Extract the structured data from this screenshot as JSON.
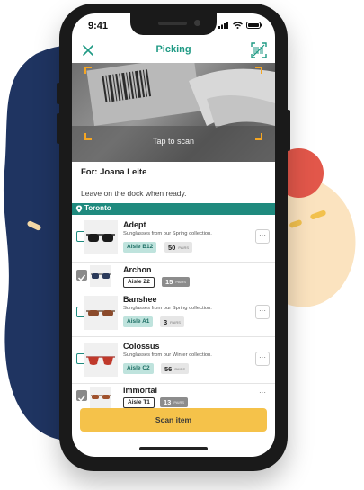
{
  "status_bar": {
    "time": "9:41"
  },
  "header": {
    "title": "Picking"
  },
  "camera": {
    "hint": "Tap to scan"
  },
  "order": {
    "for_label": "For: Joana Leite",
    "note": "Leave on the dock when ready."
  },
  "location": {
    "name": "Toronto"
  },
  "items": [
    {
      "name": "Adept",
      "description": "Sunglasses from our Spring collection.",
      "aisle": "Aisle B12",
      "qty": "50",
      "unit": "PAIRS",
      "checked": false
    },
    {
      "name": "Archon",
      "description": "",
      "aisle": "Aisle Z2",
      "qty": "15",
      "unit": "PAIRS",
      "checked": true
    },
    {
      "name": "Banshee",
      "description": "Sunglasses from our Spring collection.",
      "aisle": "Aisle A1",
      "qty": "3",
      "unit": "PAIRS",
      "checked": false
    },
    {
      "name": "Colossus",
      "description": "Sunglasses from our Winter collection.",
      "aisle": "Aisle C2",
      "qty": "56",
      "unit": "PAIRS",
      "checked": false
    },
    {
      "name": "Immortal",
      "description": "",
      "aisle": "Aisle T1",
      "qty": "13",
      "unit": "PAIRS",
      "checked": true
    }
  ],
  "actions": {
    "more": "···",
    "scan_item": "Scan item"
  },
  "colors": {
    "teal": "#1f9a84",
    "navy": "#1f3461",
    "yellow": "#f5c24a",
    "red": "#e2574a",
    "peach": "#fbe3bf"
  }
}
